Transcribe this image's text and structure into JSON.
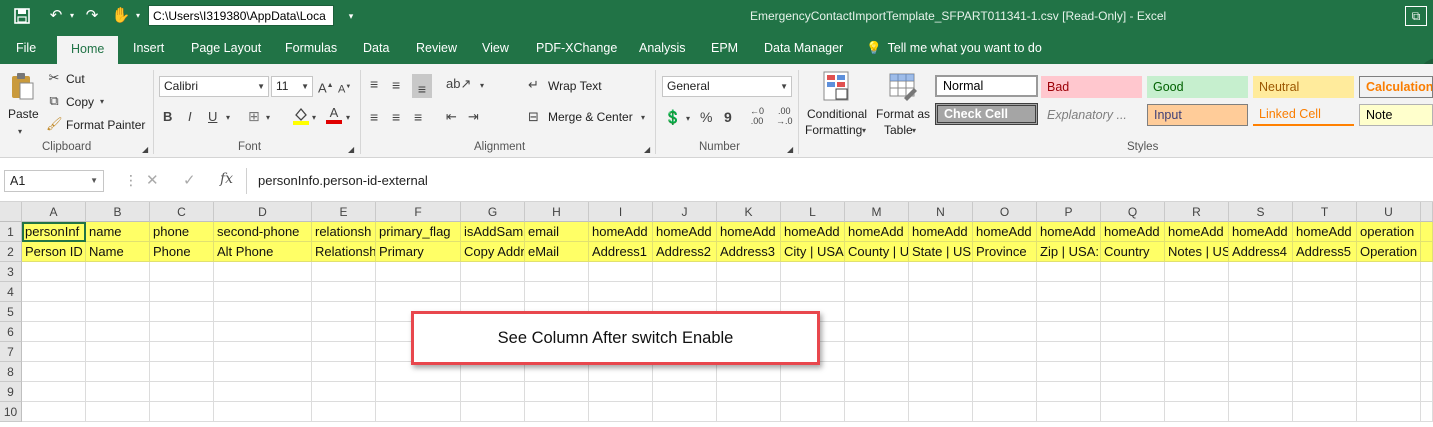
{
  "titlebar": {
    "path": "C:\\Users\\I319380\\AppData\\Loca",
    "title": "EmergencyContactImportTemplate_SFPART011341-1.csv  [Read-Only]  -  Excel",
    "restore_glyph": "⧉"
  },
  "tabs": [
    "File",
    "Home",
    "Insert",
    "Page Layout",
    "Formulas",
    "Data",
    "Review",
    "View",
    "PDF-XChange",
    "Analysis",
    "EPM",
    "Data Manager"
  ],
  "tell_me": "Tell me what you want to do",
  "ribbon": {
    "clipboard": {
      "paste": "Paste",
      "cut": "Cut",
      "copy": "Copy",
      "format_painter": "Format Painter",
      "label": "Clipboard"
    },
    "font": {
      "name": "Calibri",
      "size": "11",
      "bold": "B",
      "italic": "I",
      "underline": "U",
      "color_a": "A",
      "label": "Font"
    },
    "alignment": {
      "wrap_text": "Wrap Text",
      "merge_center": "Merge & Center",
      "label": "Alignment"
    },
    "number": {
      "format": "General",
      "percent": "%",
      "comma": "9",
      "label": "Number"
    },
    "styles": {
      "conditional": [
        "Conditional",
        "Formatting"
      ],
      "format_as_table": [
        "Format as",
        "Table"
      ],
      "cells": [
        "Normal",
        "Bad",
        "Good",
        "Neutral",
        "Calculation",
        "Check Cell",
        "Explanatory ...",
        "Input",
        "Linked Cell",
        "Note"
      ],
      "label": "Styles"
    }
  },
  "formula_bar": {
    "name_box": "A1",
    "fx": "fx",
    "formula": "personInfo.person-id-external"
  },
  "columns": [
    "A",
    "B",
    "C",
    "D",
    "E",
    "F",
    "G",
    "H",
    "I",
    "J",
    "K",
    "L",
    "M",
    "N",
    "O",
    "P",
    "Q",
    "R",
    "S",
    "T",
    "U"
  ],
  "rows": [
    "1",
    "2",
    "3",
    "4",
    "5",
    "6",
    "7",
    "8",
    "9",
    "10"
  ],
  "row1": [
    "personInf",
    "name",
    "phone",
    "second-phone",
    "relationsh",
    "primary_flag",
    "isAddSam",
    "email",
    "homeAdd",
    "homeAdd",
    "homeAdd",
    "homeAdd",
    "homeAdd",
    "homeAdd",
    "homeAdd",
    "homeAdd",
    "homeAdd",
    "homeAdd",
    "homeAdd",
    "homeAdd",
    "operation"
  ],
  "row2": [
    "Person ID",
    "Name",
    "Phone",
    "Alt Phone",
    "Relationsh",
    "Primary",
    "Copy Addr",
    "eMail",
    "Address1",
    "Address2",
    "Address3",
    "City | USA",
    "County | U",
    "State | US",
    "Province",
    "Zip | USA:",
    "Country",
    "Notes | US",
    "Address4",
    "Address5",
    "Operation"
  ],
  "annotation": "See Column After  switch Enable"
}
